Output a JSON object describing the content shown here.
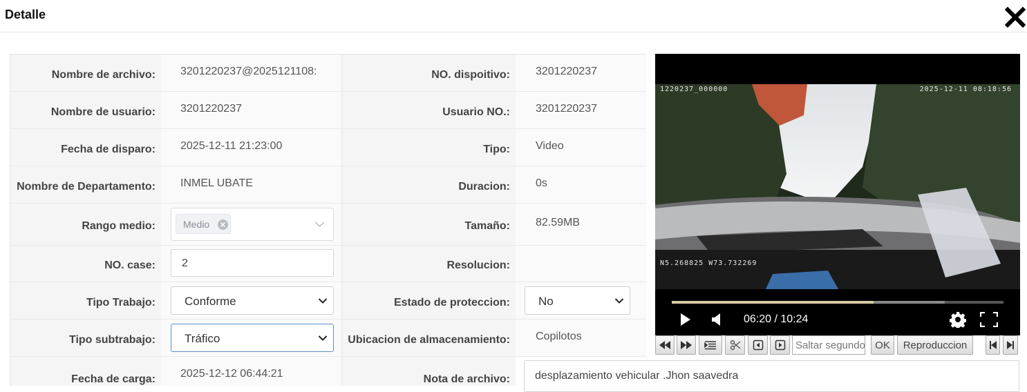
{
  "dialog": {
    "title": "Detalle",
    "close_icon": "close-icon"
  },
  "rows": [
    {
      "label1": "Nombre de archivo:",
      "value1": "3201220237@2025121108:",
      "label2": "NO. dispoitivo:",
      "value2": "3201220237"
    },
    {
      "label1": "Nombre de usuario:",
      "value1": "3201220237",
      "label2": "Usuario NO.:",
      "value2": "3201220237"
    },
    {
      "label1": "Fecha de disparo:",
      "value1": "2025-12-11 21:23:00",
      "label2": "Tipo:",
      "value2": "Video"
    },
    {
      "label1": "Nombre de Departamento:",
      "value1": "INMEL UBATE",
      "label2": "Duracion:",
      "value2": "0s"
    },
    {
      "label1": "Rango medio:",
      "tag": "Medio",
      "label2": "Tamaño:",
      "value2": "82.59MB"
    },
    {
      "label1": "NO. case:",
      "input_value": "2",
      "label2": "Resolucion:",
      "value2": ""
    },
    {
      "label1": "Tipo Trabajo:",
      "select_value": "Conforme",
      "label2": "Estado de proteccion:",
      "select2_value": "No"
    },
    {
      "label1": "Tipo subtrabajo:",
      "select_value": "Tráfico",
      "label2": "Ubicacion de almacenamiento:",
      "value2": "Copilotos"
    },
    {
      "label1": "Fecha de carga:",
      "value1": "2025-12-12 06:44:21",
      "label2": "Nota de archivo:",
      "note": "desplazamiento vehicular .Jhon saavedra"
    }
  ],
  "video": {
    "osd_id": "1220237_000000",
    "osd_datetime": "2025-12-11 08:18:56",
    "osd_gps": "N5.268825  W73.732269",
    "time_display": "06:20 / 10:24",
    "progress": 0.608,
    "buffered": 0.823
  },
  "toolbar": {
    "seek_placeholder": "Saltar segundos",
    "ok_label": "OK",
    "playback_label": "Reproduccion"
  }
}
